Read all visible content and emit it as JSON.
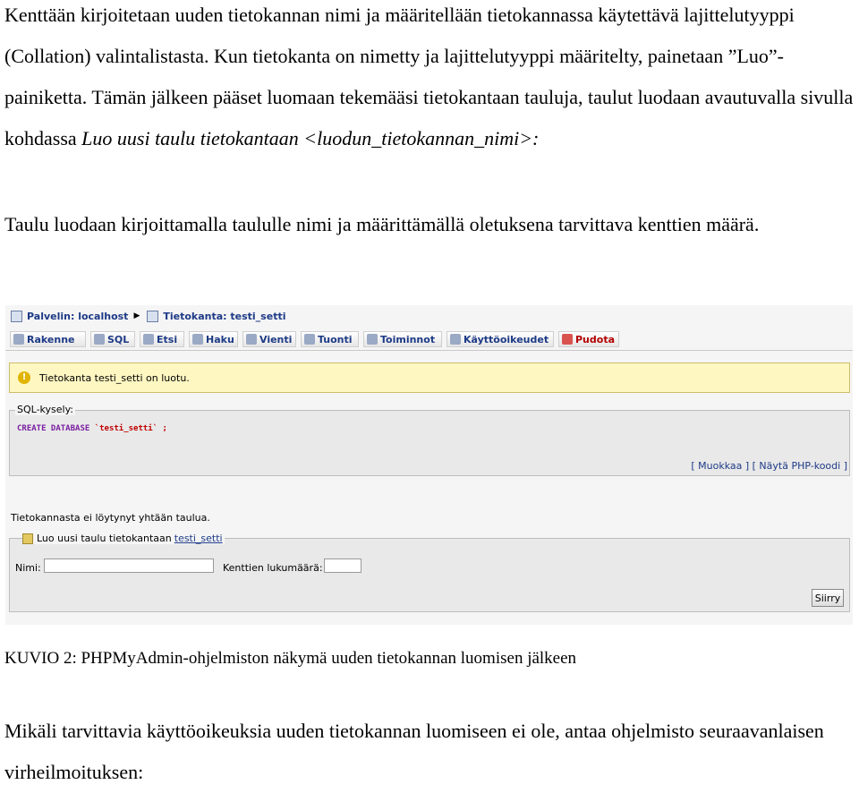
{
  "paragraph1": "Kenttään kirjoitetaan uuden tietokannan nimi ja määritellään tietokannassa käytettävä lajittelutyyppi (Collation) valintalistasta. Kun tietokanta on nimetty ja lajittelutyyppi määritelty, painetaan ”Luo”-painiketta. Tämän jälkeen pääset luomaan tekemääsi tietokantaan tauluja, taulut luodaan avautuvalla sivulla kohdassa",
  "paragraph1_italic": "Luo uusi taulu tietokantaan <luodun_tietokannan_nimi>:",
  "paragraph2": "Taulu luodaan kirjoittamalla taululle nimi ja määrittämällä oletuksena tarvittava kenttien määrä.",
  "screenshot": {
    "breadcrumb": {
      "server": "Palvelin: localhost",
      "database": "Tietokanta: testi_setti"
    },
    "tabs": [
      {
        "label": "Rakenne",
        "icon": "structure-icon"
      },
      {
        "label": "SQL",
        "icon": "sql-icon"
      },
      {
        "label": "Etsi",
        "icon": "search-icon"
      },
      {
        "label": "Haku",
        "icon": "query-icon"
      },
      {
        "label": "Vienti",
        "icon": "export-icon"
      },
      {
        "label": "Tuonti",
        "icon": "import-icon"
      },
      {
        "label": "Toiminnot",
        "icon": "operations-icon"
      },
      {
        "label": "Käyttöoikeudet",
        "icon": "privileges-icon"
      },
      {
        "label": "Pudota",
        "icon": "drop-icon"
      }
    ],
    "notice": "Tietokanta testi_setti on luotu.",
    "sql_legend": "SQL-kysely:",
    "sql_keyword": "CREATE DATABASE",
    "sql_name": "`testi_setti` ;",
    "edit_links": "[ Muokkaa ] [ Näytä PHP-koodi ]",
    "no_tables": "Tietokannasta ei löytynyt yhtään taulua.",
    "new_table_legend": "Luo uusi taulu tietokantaan",
    "new_table_db": "testi_setti",
    "name_label": "Nimi:",
    "fields_label": "Kenttien lukumäärä:",
    "go_button": "Siirry"
  },
  "caption": "KUVIO 2: PHPMyAdmin-ohjelmiston näkymä uuden tietokannan luomisen jälkeen",
  "paragraph3": "Mikäli tarvittavia käyttöoikeuksia uuden tietokannan luomiseen ei ole, antaa ohjelmisto seuraavanlaisen virheilmoituksen:"
}
